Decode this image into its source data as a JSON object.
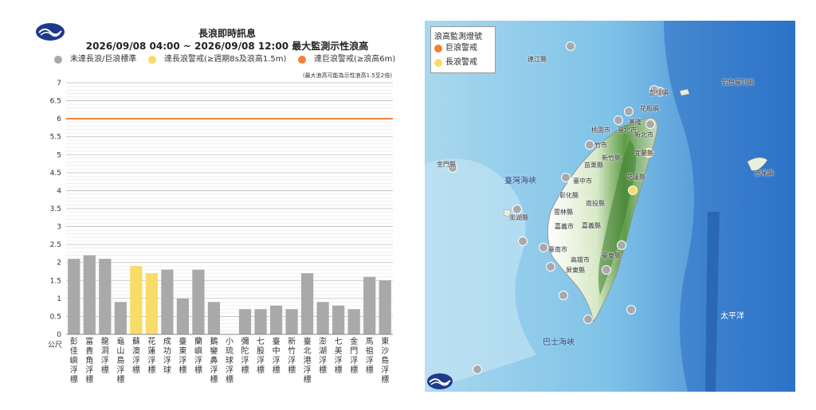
{
  "chart": {
    "title_line1": "長浪即時訊息",
    "title_line2": "2026/09/08 04:00 ~ 2026/09/08 12:00 最大監測示性浪高",
    "note": "(最大浪高可能為示性浪高1.5至2倍)",
    "unit": "公尺",
    "legend": [
      {
        "label": "未達長浪/巨浪標準",
        "color": "#a9a9a9"
      },
      {
        "label": "達長浪警戒(≥週期8s及浪高1.5m)",
        "color": "#f8dc6a"
      },
      {
        "label": "達巨浪警戒(≥浪高6m)",
        "color": "#f28236"
      }
    ]
  },
  "chart_data": {
    "type": "bar",
    "categories": [
      "彭佳嶼浮標",
      "富貴角浮標",
      "龍洞浮標",
      "龜山島浮標",
      "蘇澳浮標",
      "花蓮浮標",
      "成功浮球",
      "臺東浮標",
      "蘭嶼浮標",
      "鵝鑾鼻浮標",
      "小琉球浮標",
      "彌陀浮標",
      "七股浮標",
      "臺中浮標",
      "新竹浮標",
      "臺北港浮標",
      "澎湖浮標",
      "七美浮標",
      "金門浮標",
      "馬祖浮標",
      "東沙島浮標"
    ],
    "values": [
      2.1,
      2.2,
      2.1,
      0.9,
      1.9,
      1.7,
      1.8,
      1.0,
      1.8,
      0.9,
      null,
      0.7,
      0.7,
      0.8,
      0.7,
      1.7,
      0.9,
      0.8,
      0.7,
      1.6,
      1.5
    ],
    "status": [
      "none",
      "none",
      "none",
      "none",
      "long",
      "long",
      "none",
      "none",
      "none",
      "none",
      "none",
      "none",
      "none",
      "none",
      "none",
      "none",
      "none",
      "none",
      "none",
      "none",
      "none"
    ],
    "status_colors": {
      "none": "#a9a9a9",
      "long": "#f8dc6a",
      "huge": "#f28236"
    },
    "ylim": [
      0,
      7
    ],
    "yticks": [
      "0",
      "0.5",
      "1",
      "1.5",
      "2",
      "2.5",
      "3",
      "3.5",
      "4",
      "4.5",
      "5",
      "5.5",
      "6",
      "6.5",
      "7"
    ],
    "threshold": {
      "value": 6,
      "color": "#f28236"
    },
    "ylabel": "公尺",
    "grid": true
  },
  "map": {
    "legend_title": "浪高監測燈號",
    "legend_items": [
      {
        "label": "巨浪警戒",
        "color": "#f28236"
      },
      {
        "label": "長浪警戒",
        "color": "#f8dc6a"
      }
    ],
    "labels": [
      "連江縣",
      "金門縣",
      "澎湖縣",
      "基隆",
      "彭佳嶼",
      "花瓶嶼",
      "釣魚臺列嶼",
      "赤尾嶼",
      "桃園市",
      "臺北市",
      "新北市",
      "竹市",
      "宜蘭縣",
      "新竹縣",
      "苗栗縣",
      "臺中市",
      "彰化縣",
      "南投縣",
      "雲林縣",
      "嘉義市",
      "嘉義縣",
      "臺南市",
      "高雄市",
      "臺東縣",
      "屏東縣",
      "花蓮縣"
    ],
    "sea_labels": [
      "臺灣海峽",
      "巴士海峽",
      "太平洋"
    ]
  }
}
